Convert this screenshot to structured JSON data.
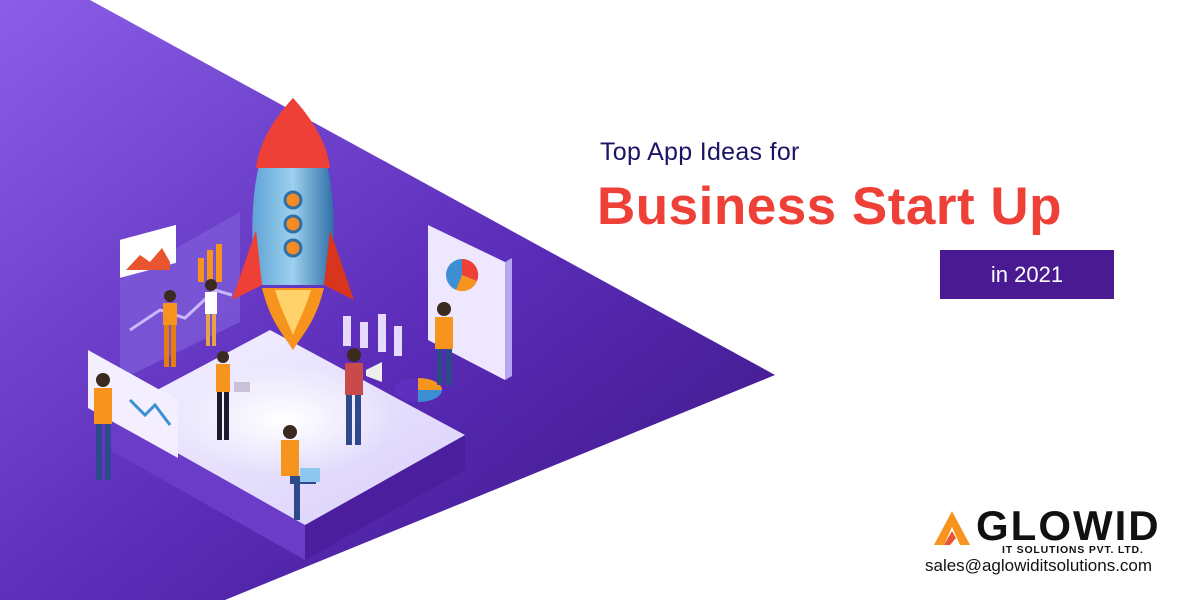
{
  "headline": {
    "line1": "Top App Ideas for",
    "line2": "Business Start Up",
    "year_label": "in 2021"
  },
  "brand": {
    "name": "GLOWID",
    "tagline": "IT SOLUTIONS PVT. LTD.",
    "email": "sales@aglowiditsolutions.com"
  },
  "colors": {
    "accent_red": "#ee4036",
    "purple_dark": "#3f1788",
    "purple_light": "#8a5ee6",
    "navy_text": "#1b1464",
    "logo_orange": "#f7941d"
  },
  "icons": [
    "rocket-icon",
    "pie-chart-icon",
    "bar-chart-icon",
    "line-chart-icon",
    "megaphone-icon",
    "laptop-icon",
    "logo-mark-icon"
  ]
}
